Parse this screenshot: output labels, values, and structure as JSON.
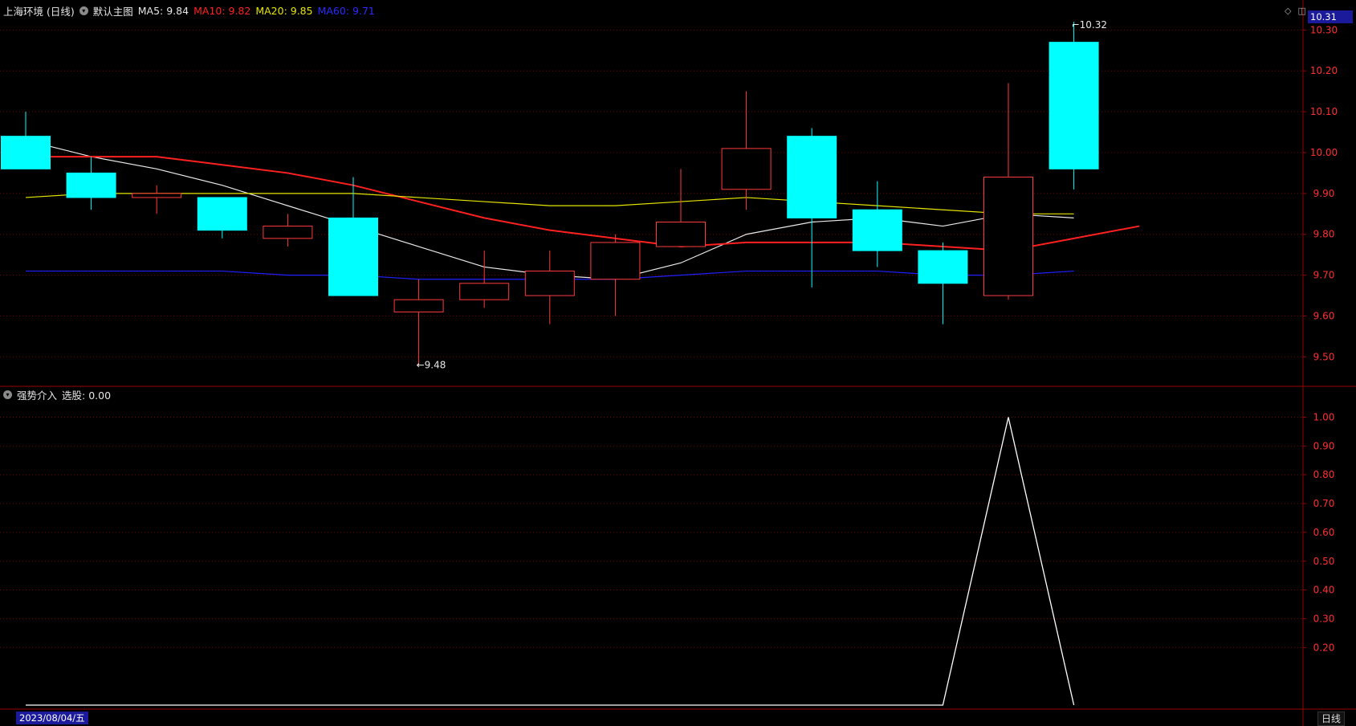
{
  "header": {
    "stock_name": "上海环境 (日线)",
    "chart_mode": "默认主图",
    "ma5_label": "MA5: 9.84",
    "ma10_label": "MA10: 9.82",
    "ma20_label": "MA20: 9.85",
    "ma60_label": "MA60: 9.71"
  },
  "indicator_header": {
    "name": "强势介入",
    "value_label": "选股: 0.00"
  },
  "top_icons": [
    "diamond-icon",
    "panel-toggle-icon"
  ],
  "price_badge": "10.31",
  "date_label": "2023/08/04/五",
  "period_label": "日线",
  "colors": {
    "up": "#ff3b3b",
    "down": "#00ffff",
    "ma5": "#e8e8e8",
    "ma10": "#ff2020",
    "ma20": "#e6e600",
    "ma60": "#2020ff",
    "grid": "#7a0000",
    "axis_text": "#ff3030"
  },
  "chart_data": [
    {
      "type": "candlestick",
      "ylim": [
        9.43,
        10.34
      ],
      "y_ticks": [
        "9.50",
        "9.60",
        "9.70",
        "9.80",
        "9.90",
        "10.00",
        "10.10",
        "10.20",
        "10.30"
      ],
      "annotations": [
        {
          "text": "9.48",
          "candle": 6
        },
        {
          "text": "10.32",
          "candle": 16
        }
      ],
      "candles": [
        {
          "o": 10.04,
          "h": 10.1,
          "l": 9.96,
          "c": 9.96
        },
        {
          "o": 9.95,
          "h": 9.99,
          "l": 9.86,
          "c": 9.89
        },
        {
          "o": 9.89,
          "h": 9.92,
          "l": 9.85,
          "c": 9.9
        },
        {
          "o": 9.89,
          "h": 9.89,
          "l": 9.79,
          "c": 9.81
        },
        {
          "o": 9.79,
          "h": 9.85,
          "l": 9.77,
          "c": 9.82
        },
        {
          "o": 9.84,
          "h": 9.94,
          "l": 9.65,
          "c": 9.65
        },
        {
          "o": 9.61,
          "h": 9.69,
          "l": 9.48,
          "c": 9.64
        },
        {
          "o": 9.64,
          "h": 9.76,
          "l": 9.62,
          "c": 9.68
        },
        {
          "o": 9.65,
          "h": 9.76,
          "l": 9.58,
          "c": 9.71
        },
        {
          "o": 9.69,
          "h": 9.8,
          "l": 9.6,
          "c": 9.78
        },
        {
          "o": 9.77,
          "h": 9.96,
          "l": 9.77,
          "c": 9.83
        },
        {
          "o": 9.91,
          "h": 10.15,
          "l": 9.86,
          "c": 10.01
        },
        {
          "o": 10.04,
          "h": 10.06,
          "l": 9.67,
          "c": 9.84
        },
        {
          "o": 9.86,
          "h": 9.93,
          "l": 9.72,
          "c": 9.76
        },
        {
          "o": 9.76,
          "h": 9.78,
          "l": 9.58,
          "c": 9.68
        },
        {
          "o": 9.65,
          "h": 10.17,
          "l": 9.64,
          "c": 9.94
        },
        {
          "o": 10.27,
          "h": 10.32,
          "l": 9.91,
          "c": 9.96
        }
      ],
      "series": [
        {
          "name": "MA5",
          "color": "#e8e8e8",
          "values": [
            10.03,
            9.99,
            9.96,
            9.92,
            9.87,
            9.82,
            9.77,
            9.72,
            9.7,
            9.69,
            9.73,
            9.8,
            9.83,
            9.84,
            9.82,
            9.85,
            9.84
          ]
        },
        {
          "name": "MA10",
          "color": "#ff2020",
          "values": [
            9.99,
            9.99,
            9.99,
            9.97,
            9.95,
            9.92,
            9.88,
            9.84,
            9.81,
            9.79,
            9.77,
            9.78,
            9.78,
            9.78,
            9.77,
            9.76,
            9.79,
            9.82
          ]
        },
        {
          "name": "MA20",
          "color": "#e6e600",
          "values": [
            9.89,
            9.9,
            9.9,
            9.9,
            9.9,
            9.9,
            9.89,
            9.88,
            9.87,
            9.87,
            9.88,
            9.89,
            9.88,
            9.87,
            9.86,
            9.85,
            9.85
          ]
        },
        {
          "name": "MA60",
          "color": "#2020ff",
          "values": [
            9.71,
            9.71,
            9.71,
            9.71,
            9.7,
            9.7,
            9.69,
            9.69,
            9.69,
            9.69,
            9.7,
            9.71,
            9.71,
            9.71,
            9.7,
            9.7,
            9.71
          ]
        }
      ]
    },
    {
      "type": "line",
      "ylim": [
        0,
        1.06
      ],
      "y_ticks": [
        "0.20",
        "0.30",
        "0.40",
        "0.50",
        "0.60",
        "0.70",
        "0.80",
        "0.90",
        "1.00"
      ],
      "series": [
        {
          "name": "选股",
          "color": "#ffffff",
          "values": [
            0,
            0,
            0,
            0,
            0,
            0,
            0,
            0,
            0,
            0,
            0,
            0,
            0,
            0,
            0,
            1,
            0
          ]
        }
      ]
    }
  ]
}
